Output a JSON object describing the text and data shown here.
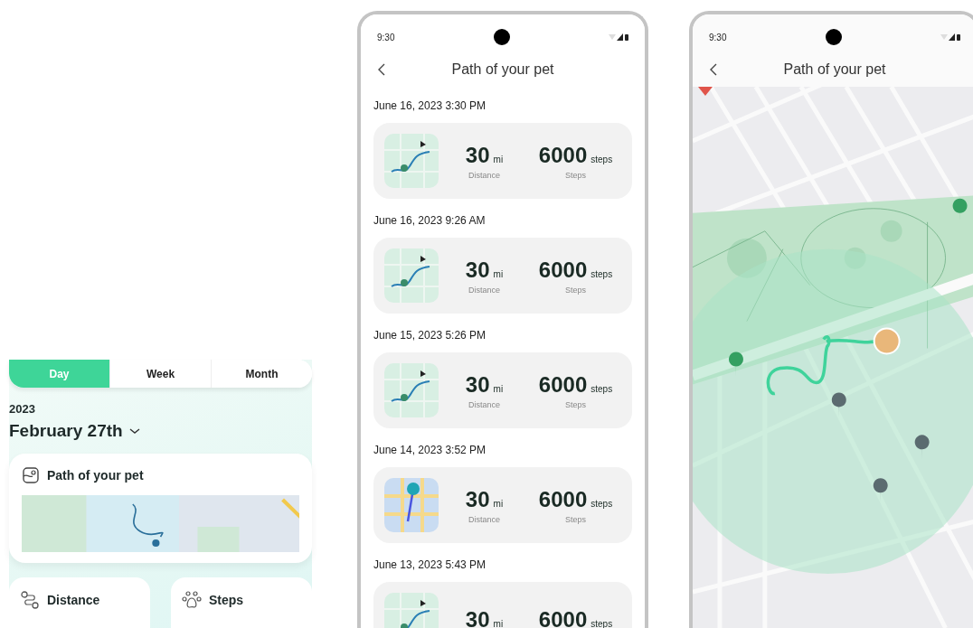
{
  "overview": {
    "tabs": [
      {
        "label": "Day",
        "selected": true
      },
      {
        "label": "Week",
        "selected": false
      },
      {
        "label": "Month",
        "selected": false
      }
    ],
    "year": "2023",
    "date": "February 27th",
    "path_card": {
      "title": "Path of your pet"
    },
    "metric_cards": [
      {
        "kind": "distance",
        "title": "Distance"
      },
      {
        "kind": "steps",
        "title": "Steps"
      }
    ]
  },
  "history_screen": {
    "status_time": "9:30",
    "title": "Path of your pet",
    "entries": [
      {
        "date": "June 16, 2023 3:30 PM",
        "kind": "park",
        "distance": "30",
        "distance_unit": "mi",
        "distance_label": "Distance",
        "steps": "6000",
        "steps_unit": "steps",
        "steps_label": "Steps"
      },
      {
        "date": "June 16, 2023 9:26 AM",
        "kind": "park",
        "distance": "30",
        "distance_unit": "mi",
        "distance_label": "Distance",
        "steps": "6000",
        "steps_unit": "steps",
        "steps_label": "Steps"
      },
      {
        "date": "June 15, 2023 5:26 PM",
        "kind": "park",
        "distance": "30",
        "distance_unit": "mi",
        "distance_label": "Distance",
        "steps": "6000",
        "steps_unit": "steps",
        "steps_label": "Steps"
      },
      {
        "date": "June 14, 2023 3:52 PM",
        "kind": "city",
        "distance": "30",
        "distance_unit": "mi",
        "distance_label": "Distance",
        "steps": "6000",
        "steps_unit": "steps",
        "steps_label": "Steps"
      },
      {
        "date": "June 13, 2023 5:43 PM",
        "kind": "park",
        "distance": "30",
        "distance_unit": "mi",
        "steps": "6000",
        "steps_unit": "steps"
      }
    ]
  },
  "map_screen": {
    "status_time": "9:30",
    "title": "Path of your pet"
  }
}
